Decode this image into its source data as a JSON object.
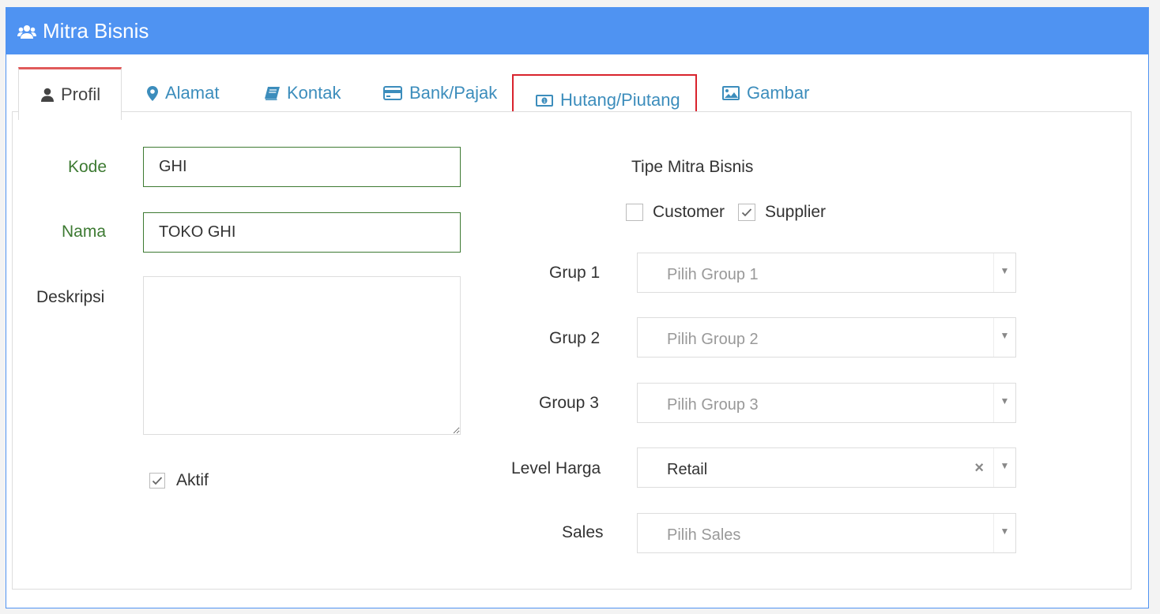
{
  "window": {
    "title": "Mitra Bisnis",
    "title_icon": "users-icon",
    "header_color": "#4f93f2"
  },
  "tabs": [
    {
      "label": "Profil",
      "icon": "user-icon",
      "active": true
    },
    {
      "label": "Alamat",
      "icon": "map-marker-icon",
      "active": false
    },
    {
      "label": "Kontak",
      "icon": "book-icon",
      "active": false
    },
    {
      "label": "Bank/Pajak",
      "icon": "credit-card-icon",
      "active": false
    },
    {
      "label": "Hutang/Piutang",
      "icon": "money-icon",
      "active": false,
      "highlighted": true
    },
    {
      "label": "Gambar",
      "icon": "image-icon",
      "active": false
    }
  ],
  "form": {
    "kode": {
      "label": "Kode",
      "value": "GHI"
    },
    "nama": {
      "label": "Nama",
      "value": "TOKO GHI"
    },
    "deskripsi": {
      "label": "Deskripsi",
      "value": ""
    },
    "aktif": {
      "label": "Aktif",
      "checked": true
    }
  },
  "tipe": {
    "title": "Tipe Mitra Bisnis",
    "customer": {
      "label": "Customer",
      "checked": false
    },
    "supplier": {
      "label": "Supplier",
      "checked": true
    }
  },
  "selects": {
    "grup1": {
      "label": "Grup 1",
      "placeholder": "Pilih Group 1"
    },
    "grup2": {
      "label": "Grup 2",
      "placeholder": "Pilih Group 2"
    },
    "group3": {
      "label": "Group 3",
      "placeholder": "Pilih Group 3"
    },
    "level_harga": {
      "label": "Level Harga",
      "value": "Retail",
      "clear_symbol": "×"
    },
    "sales": {
      "label": "Sales",
      "placeholder": "Pilih Sales"
    }
  },
  "colors": {
    "accent": "#3c8dbc",
    "label_green": "#3d7a32",
    "active_tab_border": "#e05a5a",
    "highlight_box": "#d9232d"
  }
}
